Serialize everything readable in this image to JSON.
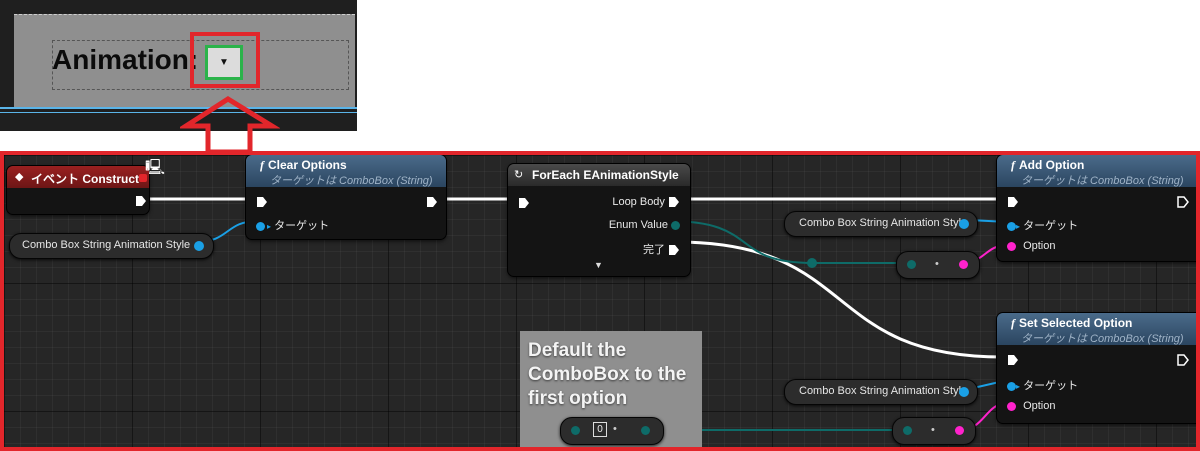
{
  "designer": {
    "label": "Animation:",
    "combo_arrow_icon": "caret-down-icon"
  },
  "graph": {
    "event_node": {
      "title": "イベント Construct"
    },
    "clear_options": {
      "title": "Clear Options",
      "subtitle": "ターゲットは ComboBox (String)",
      "target_label": "ターゲット"
    },
    "foreach": {
      "title": "ForEach EAnimationStyle",
      "loop_body": "Loop Body",
      "enum_value": "Enum Value",
      "completed": "完了"
    },
    "add_option": {
      "title": "Add Option",
      "subtitle": "ターゲットは ComboBox (String)",
      "target_label": "ターゲット",
      "option_label": "Option"
    },
    "set_selected": {
      "title": "Set Selected Option",
      "subtitle": "ターゲットは ComboBox (String)",
      "target_label": "ターゲット",
      "option_label": "Option"
    },
    "var_1": "Combo Box String Animation Style",
    "var_2": "Combo Box String Animation Style",
    "var_3": "Combo Box String Animation Style",
    "comment": "Default the ComboBox to the first option",
    "literal_index": "0"
  },
  "colors": {
    "highlight_red": "#e2262b",
    "highlight_green": "#2bb34a",
    "event_header": "#8b1b1b",
    "function_header": "#3c5a77",
    "object_pin": "#1aa0e6",
    "string_pin": "#ff22cc",
    "byte_pin": "#0e6b68"
  }
}
